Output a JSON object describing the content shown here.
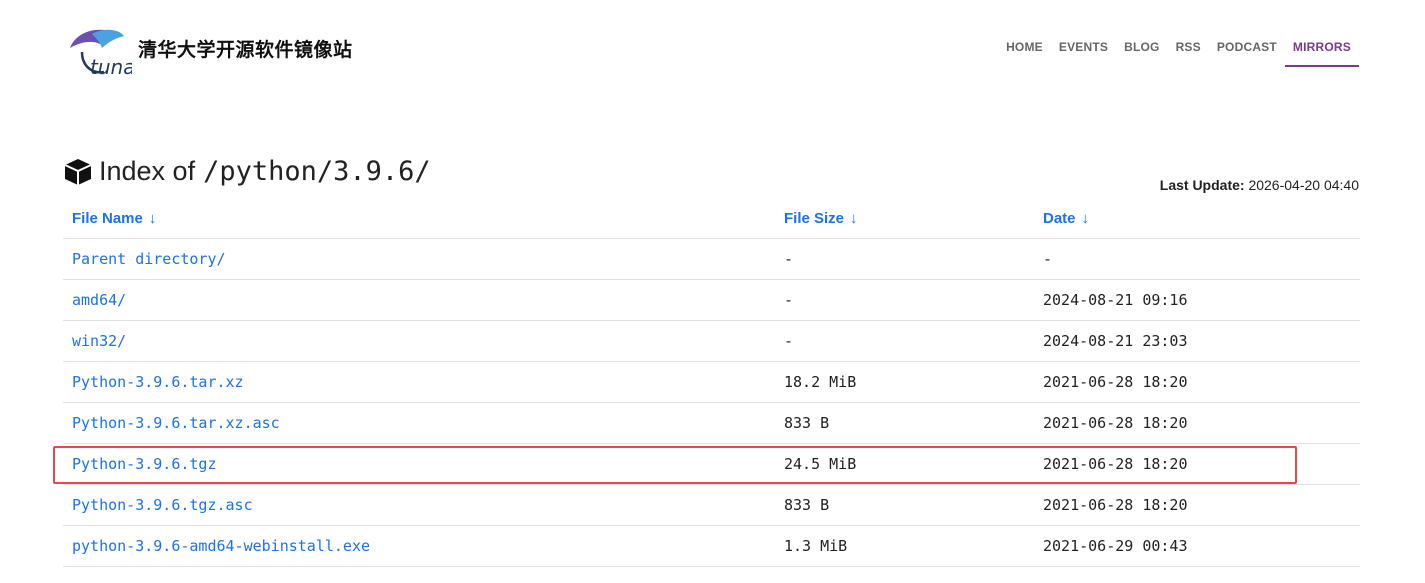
{
  "site": {
    "title": "清华大学开源软件镜像站",
    "logo_text": "tuna"
  },
  "nav": [
    "HOME",
    "EVENTS",
    "BLOG",
    "RSS",
    "PODCAST",
    "MIRRORS"
  ],
  "nav_active": "MIRRORS",
  "heading": {
    "prefix": "Index of",
    "path": "/python/3.9.6/"
  },
  "last_update": {
    "label": "Last Update:",
    "value": "2026-04-20 04:40"
  },
  "table": {
    "columns": [
      "File Name",
      "File Size",
      "Date"
    ],
    "sort_icon": "↓",
    "rows": [
      {
        "name": "Parent directory/",
        "size": "-",
        "date": "-"
      },
      {
        "name": "amd64/",
        "size": "-",
        "date": "2024-08-21 09:16"
      },
      {
        "name": "win32/",
        "size": "-",
        "date": "2024-08-21 23:03"
      },
      {
        "name": "Python-3.9.6.tar.xz",
        "size": "18.2 MiB",
        "date": "2021-06-28 18:20"
      },
      {
        "name": "Python-3.9.6.tar.xz.asc",
        "size": "833 B",
        "date": "2021-06-28 18:20"
      },
      {
        "name": "Python-3.9.6.tgz",
        "size": "24.5 MiB",
        "date": "2021-06-28 18:20"
      },
      {
        "name": "Python-3.9.6.tgz.asc",
        "size": "833 B",
        "date": "2021-06-28 18:20"
      },
      {
        "name": "python-3.9.6-amd64-webinstall.exe",
        "size": "1.3 MiB",
        "date": "2021-06-29 00:43"
      }
    ]
  },
  "highlight_color": "#e5484d",
  "accent_color": "#7a3a8c",
  "link_color": "#1a73e8"
}
